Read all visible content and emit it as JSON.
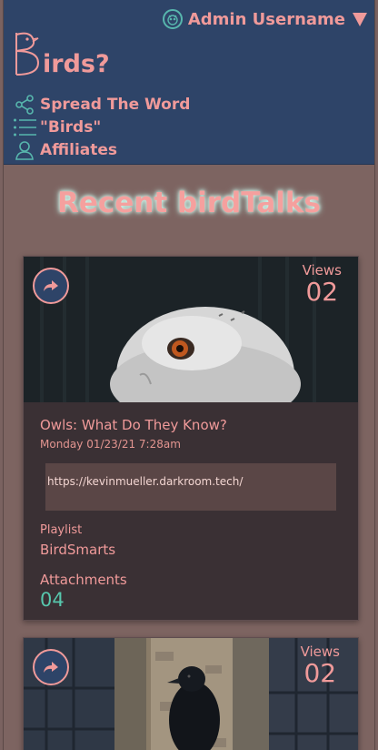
{
  "header": {
    "user": "Admin Username",
    "brand_text": "irds?",
    "nav": [
      {
        "label": "Spread The Word",
        "icon": "share-icon"
      },
      {
        "label": "\"Birds\"",
        "icon": "list-icon"
      },
      {
        "label": "Affiliates",
        "icon": "person-icon"
      }
    ]
  },
  "main": {
    "section_title": "Recent birdTalks",
    "posts": [
      {
        "views_label": "Views",
        "views": "02",
        "title": "Owls: What Do They Know?",
        "date": "Monday 01/23/21 7:28am",
        "url": "https://kevinmueller.darkroom.tech/",
        "playlist_label": "Playlist",
        "playlist": "BirdSmarts",
        "attachments_label": "Attachments",
        "attachments": "04"
      },
      {
        "views_label": "Views",
        "views": "02"
      }
    ]
  },
  "colors": {
    "header_bg": "#2e4468",
    "page_bg": "#7d6461",
    "accent_pink": "#f09a9a",
    "accent_teal": "#57b6ad",
    "card_bg": "#3a3034"
  }
}
